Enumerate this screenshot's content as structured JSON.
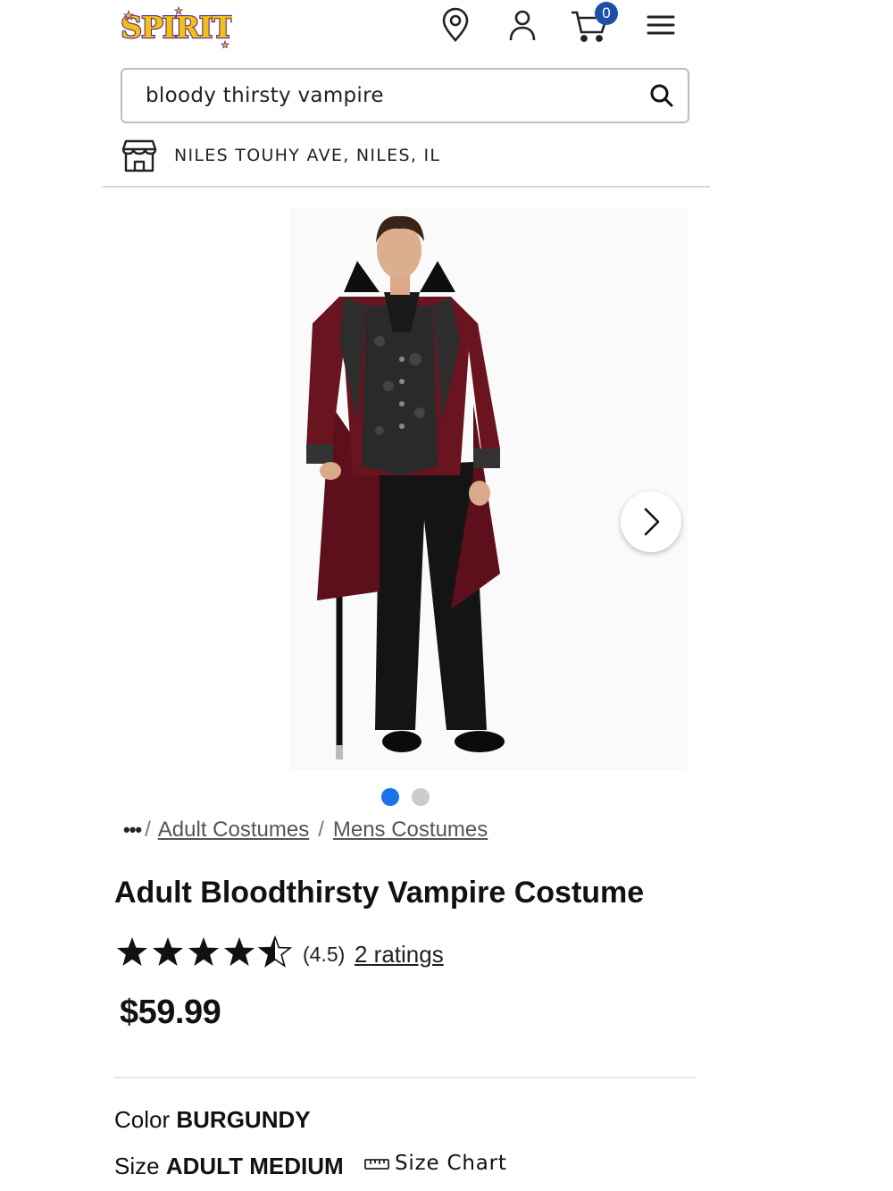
{
  "header": {
    "logo_text": "SPIRIT",
    "cart_count": "0",
    "icons": [
      "store-locator-icon",
      "account-icon",
      "cart-icon",
      "menu-icon"
    ]
  },
  "search": {
    "value": "bloody thirsty vampire"
  },
  "store": {
    "label": "NILES TOUHY AVE, NILES, IL"
  },
  "gallery": {
    "image_count": 2,
    "active_index": 0
  },
  "breadcrumb": {
    "more": "•••",
    "items": [
      "Adult Costumes",
      "Mens Costumes"
    ]
  },
  "product": {
    "title": "Adult Bloodthirsty Vampire Costume",
    "rating": 4.5,
    "rating_text": "(4.5)",
    "ratings_link": "2 ratings",
    "price": "$59.99",
    "color_label": "Color",
    "color_value": "BURGUNDY",
    "size_label": "Size",
    "size_value": "ADULT MEDIUM",
    "size_chart": "Size Chart"
  },
  "colors": {
    "brand_gold": "#f3c013",
    "brand_purple": "#5b2a86",
    "badge": "#1f4ea8",
    "dot_active": "#1a73e8",
    "dot_inactive": "#cccccc",
    "burgundy": "#6a1420"
  }
}
